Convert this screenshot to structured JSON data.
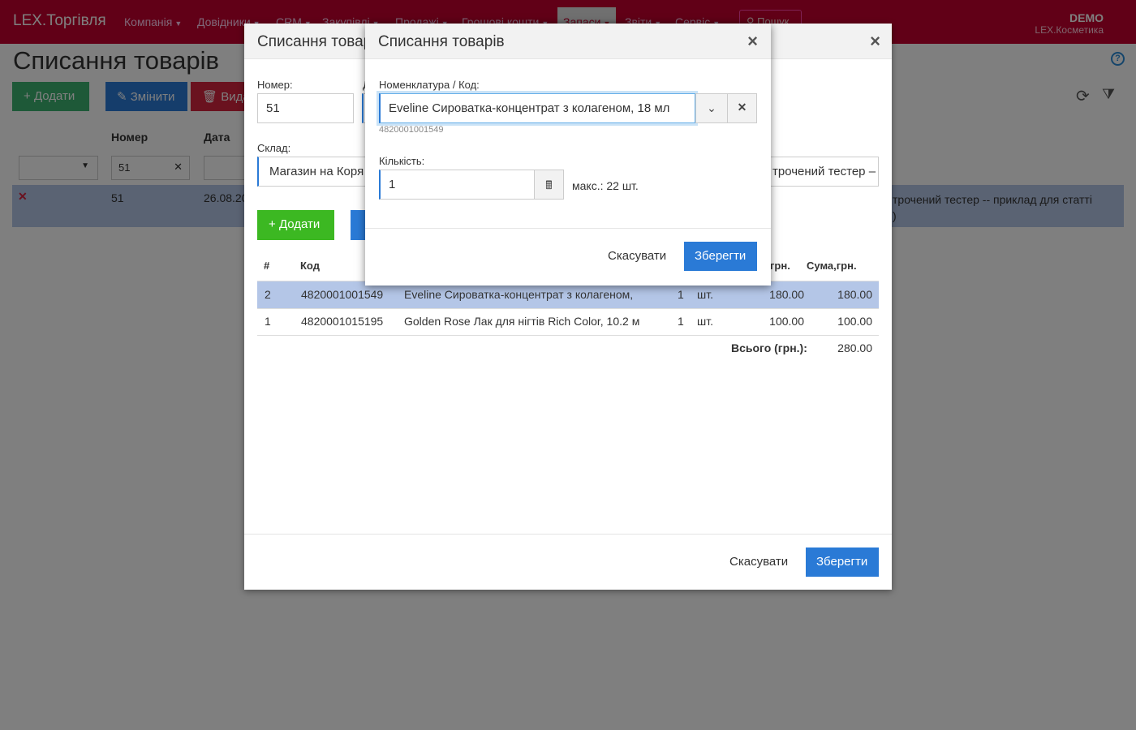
{
  "navbar": {
    "brand": "LEX.Торгівля",
    "items": [
      "Компанія",
      "Довідники",
      "CRM",
      "Закупівлі",
      "Продажі",
      "Грошові кошти",
      "Запаси",
      "Звіти",
      "Сервіс"
    ],
    "search_label": "Пошук",
    "user": "DEMO",
    "org": "LEX.Косметика"
  },
  "page": {
    "title": "Списання товарів",
    "add_label": "Додати",
    "edit_label": "Змінити",
    "delete_label": "Вида",
    "columns": [
      "Номер",
      "Дата"
    ],
    "filter_number": "51",
    "row": {
      "number": "51",
      "date": "26.08.20",
      "desc": "трочений тестер -- приклад для статті",
      "desc2": ")"
    }
  },
  "main_modal": {
    "title": "Списання товар",
    "number_label": "Номер:",
    "number_value": "51",
    "date_label": "Д",
    "warehouse_label": "Склад:",
    "warehouse_value": "Магазин на Коря",
    "comment_value": "трочений тестер –",
    "add_label": "Додати",
    "table": {
      "headers": [
        "#",
        "Код",
        "грн.",
        "Сума,грн."
      ],
      "rows": [
        {
          "n": "2",
          "code": "4820001001549",
          "name": "Eveline Сироватка-концентрат з колагеном,",
          "qty": "1",
          "unit": "шт.",
          "price": "180.00",
          "sum": "180.00"
        },
        {
          "n": "1",
          "code": "4820001015195",
          "name": "Golden Rose Лак для нігтів Rich Color, 10.2 м",
          "qty": "1",
          "unit": "шт.",
          "price": "100.00",
          "sum": "100.00"
        }
      ],
      "total_label": "Всього (грн.):",
      "total_value": "280.00"
    },
    "cancel_label": "Скасувати",
    "save_label": "Зберегти"
  },
  "item_modal": {
    "title": "Списання товарів",
    "product_label": "Номенклатура / Код:",
    "product_value": "Eveline Сироватка-концентрат з колагеном, 18 мл",
    "product_code": "4820001001549",
    "qty_label": "Кількість:",
    "qty_value": "1",
    "max_text": "макс.: 22 шт.",
    "cancel_label": "Скасувати",
    "save_label": "Зберегти"
  },
  "colors": {
    "navbar": "#c2002f",
    "primary": "#2a7ad6",
    "success": "#3cb822",
    "selected_row": "#b4c6e7"
  },
  "icons": [
    "search-icon",
    "help-icon",
    "refresh-icon",
    "filter-icon",
    "close-icon",
    "chevron-down-icon",
    "calculator-icon",
    "plus-icon",
    "edit-icon",
    "trash-icon"
  ]
}
